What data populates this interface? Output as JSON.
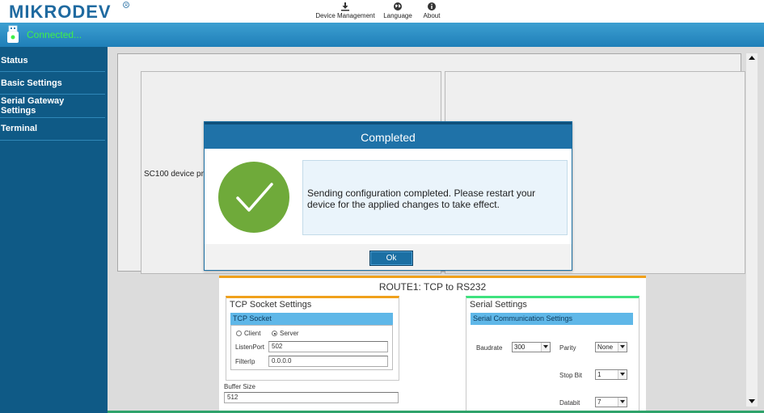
{
  "app": {
    "logo_text": "MIKRODEV",
    "toolbar": [
      {
        "label": "Device Management",
        "icon": "download-icon"
      },
      {
        "label": "Language",
        "icon": "globe-icon"
      },
      {
        "label": "About",
        "icon": "info-icon"
      }
    ],
    "connection_status": "Connected...",
    "colors": {
      "header": "#1f7fb8",
      "sidebar": "#0f5a86",
      "connected": "#3ef04a",
      "success": "#6faa3a"
    }
  },
  "sidebar": {
    "items": [
      {
        "label": "Status"
      },
      {
        "label": "Basic Settings"
      },
      {
        "label_line1": "Serial Gateway",
        "label_line2": "Settings"
      },
      {
        "label": "Terminal"
      }
    ]
  },
  "main": {
    "panel_text": "SC100 device provide",
    "route_title": "ROUTE1: TCP  to RS232",
    "tcp": {
      "group_title": "TCP Socket Settings",
      "sub_title": "TCP Socket",
      "mode_options": [
        "Client",
        "Server"
      ],
      "mode_selected": "Server",
      "listen_port_label": "ListenPort",
      "listen_port_value": "502",
      "filter_ip_label": "FilterIp",
      "filter_ip_value": "0.0.0.0"
    },
    "buffer": {
      "label": "Buffer Size",
      "value": "512"
    },
    "serial": {
      "group_title": "Serial Settings",
      "sub_title": "Serial Communication Settings",
      "baudrate_label": "Baudrate",
      "baudrate_value": "300",
      "parity_label": "Parity",
      "parity_value": "None",
      "stop_bit_label": "Stop Bit",
      "stop_bit_value": "1",
      "databit_label": "Databit",
      "databit_value": "7"
    }
  },
  "modal": {
    "title": "Completed",
    "message": "Sending configuration completed. Please restart your device for the applied changes to take effect.",
    "ok_label": "Ok",
    "icon": "checkmark-circle-icon"
  }
}
